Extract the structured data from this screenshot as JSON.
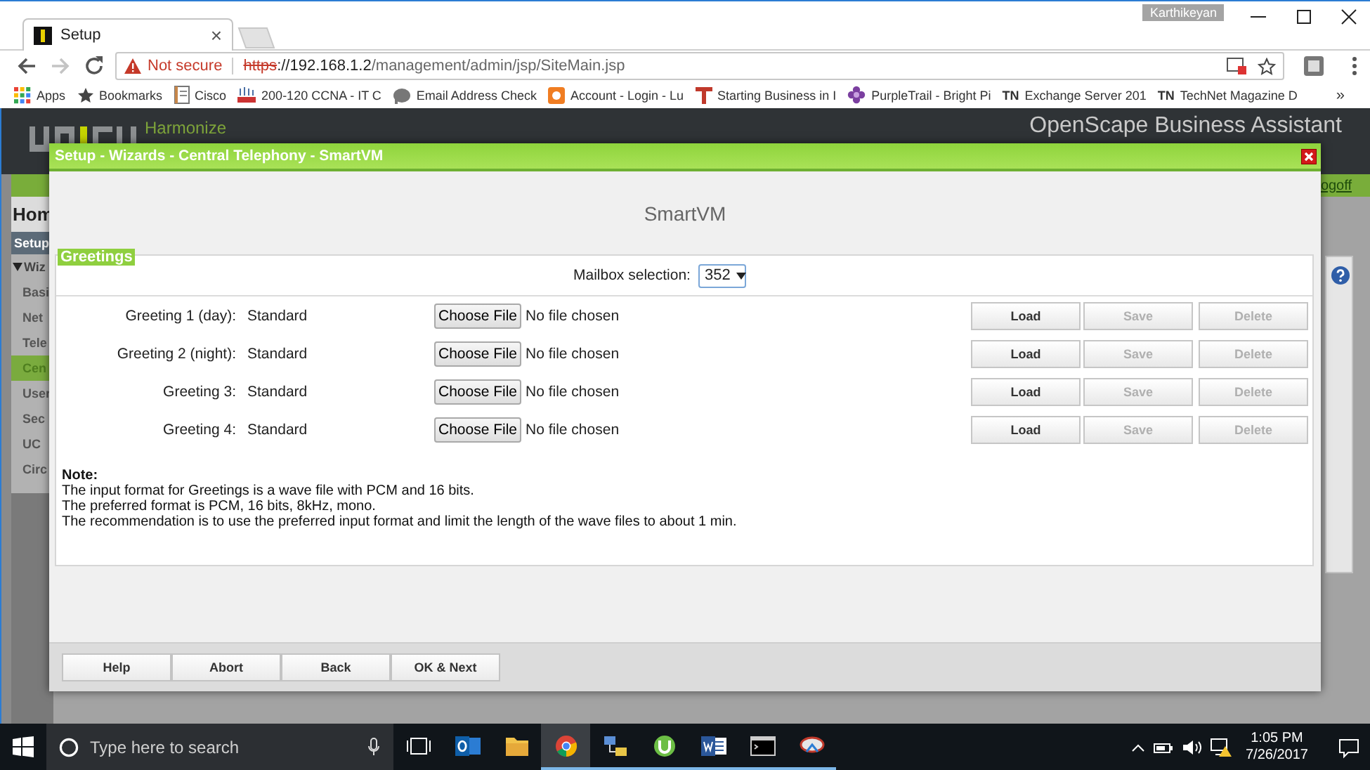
{
  "browser": {
    "tabs": [
      {
        "title": "Setup",
        "close": "×",
        "selected": true
      }
    ],
    "profile": "Karthikeyan",
    "nav_buttons": [
      {
        "kind": "back",
        "disabled": false
      },
      {
        "kind": "forward",
        "disabled": true
      },
      {
        "kind": "reload",
        "disabled": false
      }
    ],
    "address": {
      "security": "Not secure",
      "scheme": "https",
      "host": "://192.168.1.2",
      "path": "/management/admin/jsp/SiteMain.jsp"
    },
    "bookmarks": [
      {
        "kind": "apps",
        "label": "Apps"
      },
      {
        "kind": "star",
        "label": "Bookmarks"
      },
      {
        "kind": "notebook",
        "label": "Cisco"
      },
      {
        "kind": "bars",
        "label": "200-120 CCNA - IT C"
      },
      {
        "kind": "blob",
        "label": "Email Address Check"
      },
      {
        "kind": "shield",
        "label": "Account - Login - Lu"
      },
      {
        "kind": "tee",
        "label": "Starting Business in I"
      },
      {
        "kind": "flower",
        "label": "PurpleTrail - Bright Pi"
      },
      {
        "kind": "text",
        "icon_text": "TN",
        "label": "Exchange Server 201"
      },
      {
        "kind": "text",
        "icon_text": "TN",
        "label": "TechNet Magazine D"
      }
    ],
    "overflow": "»"
  },
  "app": {
    "brand": "Harmonize",
    "product": "OpenScape Business Assistant",
    "logoff": "ogoff",
    "home": "Hom",
    "nav": [
      {
        "kind": "header",
        "label": "Setup",
        "selected": false
      },
      {
        "kind": "group",
        "label": "Wiz",
        "selected": false
      },
      {
        "kind": "item",
        "label": "Basi",
        "selected": false
      },
      {
        "kind": "item",
        "label": "Net",
        "selected": false
      },
      {
        "kind": "item",
        "label": "Tele",
        "selected": false
      },
      {
        "kind": "item",
        "label": "Cen",
        "selected": true
      },
      {
        "kind": "item",
        "label": "User",
        "selected": false
      },
      {
        "kind": "item",
        "label": "Sec",
        "selected": false
      },
      {
        "kind": "item",
        "label": "UC",
        "selected": false
      },
      {
        "kind": "item",
        "label": "Circ",
        "selected": false
      }
    ]
  },
  "dialog": {
    "title": "Setup - Wizards - Central Telephony - SmartVM",
    "heading": "SmartVM",
    "section": "Greetings",
    "mailbox": {
      "label": "Mailbox selection:",
      "value": "352"
    },
    "greetings": [
      {
        "label": "Greeting 1 (day):",
        "status": "Standard",
        "file_button": "Choose File",
        "file_status": "No file chosen",
        "actions": [
          {
            "label": "Load",
            "disabled": false
          },
          {
            "label": "Save",
            "disabled": true
          },
          {
            "label": "Delete",
            "disabled": true
          }
        ]
      },
      {
        "label": "Greeting 2 (night):",
        "status": "Standard",
        "file_button": "Choose File",
        "file_status": "No file chosen",
        "actions": [
          {
            "label": "Load",
            "disabled": false
          },
          {
            "label": "Save",
            "disabled": true
          },
          {
            "label": "Delete",
            "disabled": true
          }
        ]
      },
      {
        "label": "Greeting 3:",
        "status": "Standard",
        "file_button": "Choose File",
        "file_status": "No file chosen",
        "actions": [
          {
            "label": "Load",
            "disabled": false
          },
          {
            "label": "Save",
            "disabled": true
          },
          {
            "label": "Delete",
            "disabled": true
          }
        ]
      },
      {
        "label": "Greeting 4:",
        "status": "Standard",
        "file_button": "Choose File",
        "file_status": "No file chosen",
        "actions": [
          {
            "label": "Load",
            "disabled": false
          },
          {
            "label": "Save",
            "disabled": true
          },
          {
            "label": "Delete",
            "disabled": true
          }
        ]
      }
    ],
    "note": {
      "title": "Note:",
      "lines": [
        "The input format for Greetings is a wave file with PCM and 16 bits.",
        "The preferred format is PCM, 16 bits, 8kHz, mono.",
        "The recommendation is to use the preferred input format and limit the length of the wave files to about 1 min."
      ]
    },
    "buttons": [
      "Help",
      "Abort",
      "Back",
      "OK & Next"
    ]
  },
  "taskbar": {
    "search": {
      "placeholder": "Type here to search"
    },
    "apps": [
      {
        "kind": "taskview",
        "selected": false,
        "running": false
      },
      {
        "kind": "outlook",
        "selected": false,
        "running": false
      },
      {
        "kind": "folder",
        "selected": false,
        "running": false
      },
      {
        "kind": "chrome",
        "selected": true,
        "running": true
      },
      {
        "kind": "network",
        "selected": false,
        "running": true
      },
      {
        "kind": "torrent",
        "selected": false,
        "running": true
      },
      {
        "kind": "word",
        "selected": false,
        "running": true
      },
      {
        "kind": "console",
        "selected": false,
        "running": true
      },
      {
        "kind": "snip",
        "selected": false,
        "running": true
      }
    ],
    "time": "1:05 PM",
    "date": "7/26/2017"
  }
}
